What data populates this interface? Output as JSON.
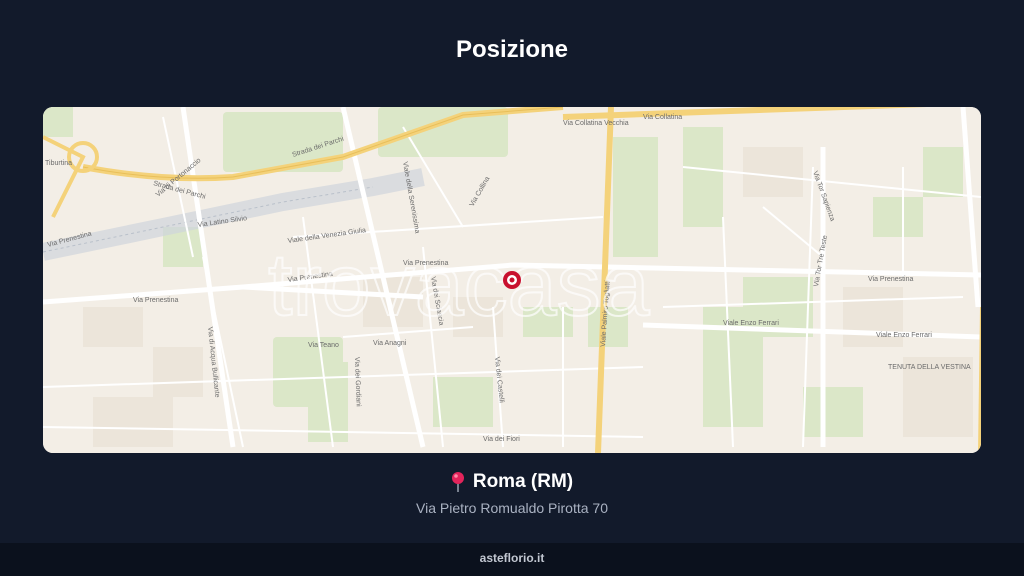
{
  "section": {
    "title": "Posizione"
  },
  "map": {
    "watermark": "trovacasa",
    "marker_color": "#c8102e",
    "streets": {
      "tiburtina": "Tiburtina",
      "strada_parchi_top": "Strada dei Parchi",
      "strada_parchi_left": "Strada dei Parchi",
      "collatina_top": "Via Collatina Vecchia",
      "collatina_top_right": "Via Collatina",
      "portonaccio": "Via di Portonaccio",
      "prenestina_left": "Via Prenestina",
      "latina_serra": "Via Latino Silvio",
      "prenestina_mid": "Via Prenestina",
      "prenestina_center": "Via Prenestina",
      "prenestina_right": "Via Prenestina",
      "prenestina_far_right": "Via Prenestina",
      "venezia_giulia": "Viale della Venezia Giulia",
      "serenissima": "Viale della Serenissima",
      "palmiro_togliatti": "Viale Palmiro Togliatti",
      "enzo_ferrari_1": "Viale Enzo Ferrari",
      "enzo_ferrari_2": "Viale Enzo Ferrari",
      "acqua_bullicante": "Via di Acqua Bullicante",
      "teano": "Via Teano",
      "anagni": "Via Anagni",
      "tor_sapienza": "Via Tor Sapienza",
      "tor_tre_teste": "Via Tor Tre Teste",
      "tenuta_vestina": "TENUTA DELLA VESTINA",
      "fiori": "Via dei Fiori",
      "castelli": "Via dei Castelli",
      "collina": "Via Collina",
      "sciascia": "Via dei Sciascia",
      "gordiani": "Via dei Gordiani"
    }
  },
  "location": {
    "city": "Roma (RM)",
    "address": "Via Pietro Romualdo Pirotta 70"
  },
  "footer": {
    "brand": "asteflorio.it"
  }
}
